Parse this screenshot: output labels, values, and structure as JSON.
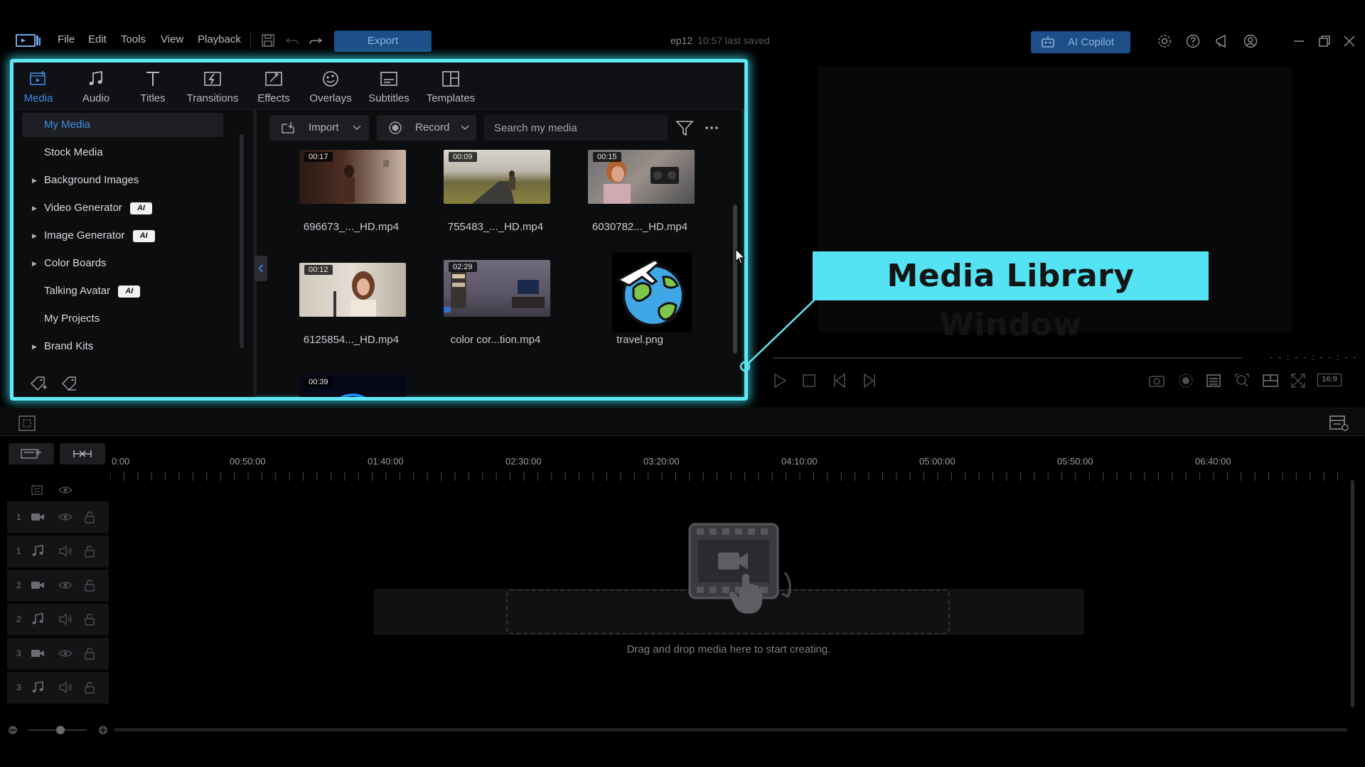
{
  "menu": [
    "File",
    "Edit",
    "Tools",
    "View",
    "Playback"
  ],
  "toolbar": {
    "export_label": "Export"
  },
  "project": {
    "name": "ep12",
    "save_status": "10:57 last saved"
  },
  "ai_copilot_label": "AI Copilot",
  "rooms": [
    {
      "label": "Media",
      "icon": "media-icon",
      "active": true
    },
    {
      "label": "Audio",
      "icon": "music-note-icon"
    },
    {
      "label": "Titles",
      "icon": "title-t-icon"
    },
    {
      "label": "Transitions",
      "icon": "transition-icon"
    },
    {
      "label": "Effects",
      "icon": "effects-icon"
    },
    {
      "label": "Overlays",
      "icon": "overlay-icon"
    },
    {
      "label": "Subtitles",
      "icon": "subtitles-icon"
    },
    {
      "label": "Templates",
      "icon": "templates-icon"
    }
  ],
  "library": {
    "items": [
      {
        "label": "My Media",
        "active": true
      },
      {
        "label": "Stock Media"
      },
      {
        "label": "Background Images",
        "expandable": true
      },
      {
        "label": "Video Generator",
        "expandable": true,
        "badge": "AI"
      },
      {
        "label": "Image Generator",
        "expandable": true,
        "badge": "AI"
      },
      {
        "label": "Color Boards",
        "expandable": true
      },
      {
        "label": "Talking Avatar",
        "badge": "AI"
      },
      {
        "label": "My Projects"
      },
      {
        "label": "Brand Kits",
        "expandable": true
      }
    ],
    "import_label": "Import",
    "record_label": "Record",
    "search_placeholder": "Search my media",
    "media": [
      {
        "duration": "00:17",
        "name": "696673_..._HD.mp4"
      },
      {
        "duration": "00:09",
        "name": "755483_..._HD.mp4"
      },
      {
        "duration": "00:15",
        "name": "6030782..._HD.mp4"
      },
      {
        "duration": "00:12",
        "name": "6125854..._HD.mp4"
      },
      {
        "duration": "02:29",
        "name": "color cor...tion.mp4"
      },
      {
        "duration": "",
        "name": "travel.png"
      },
      {
        "duration": "00:39",
        "name": ""
      }
    ]
  },
  "callout": {
    "label": "Media Library Window"
  },
  "preview": {
    "timecode": "- - : - - : - - : - -",
    "aspect_ratio": "16:9"
  },
  "timeline": {
    "ruler_labels": [
      "0:00",
      "00:50:00",
      "01:40:00",
      "02:30:00",
      "03:20:00",
      "04:10:00",
      "05:00:00",
      "05:50:00",
      "06:40:00"
    ],
    "tracks": [
      {
        "num": "1",
        "type": "video"
      },
      {
        "num": "1",
        "type": "audio"
      },
      {
        "num": "2",
        "type": "video"
      },
      {
        "num": "2",
        "type": "audio"
      },
      {
        "num": "3",
        "type": "video"
      },
      {
        "num": "3",
        "type": "audio"
      }
    ],
    "drop_hint": "Drag and drop media here to start creating."
  },
  "colors": {
    "accent": "#3b8de4",
    "highlight": "#5fe8f4",
    "export_bg": "#1e4e87"
  }
}
